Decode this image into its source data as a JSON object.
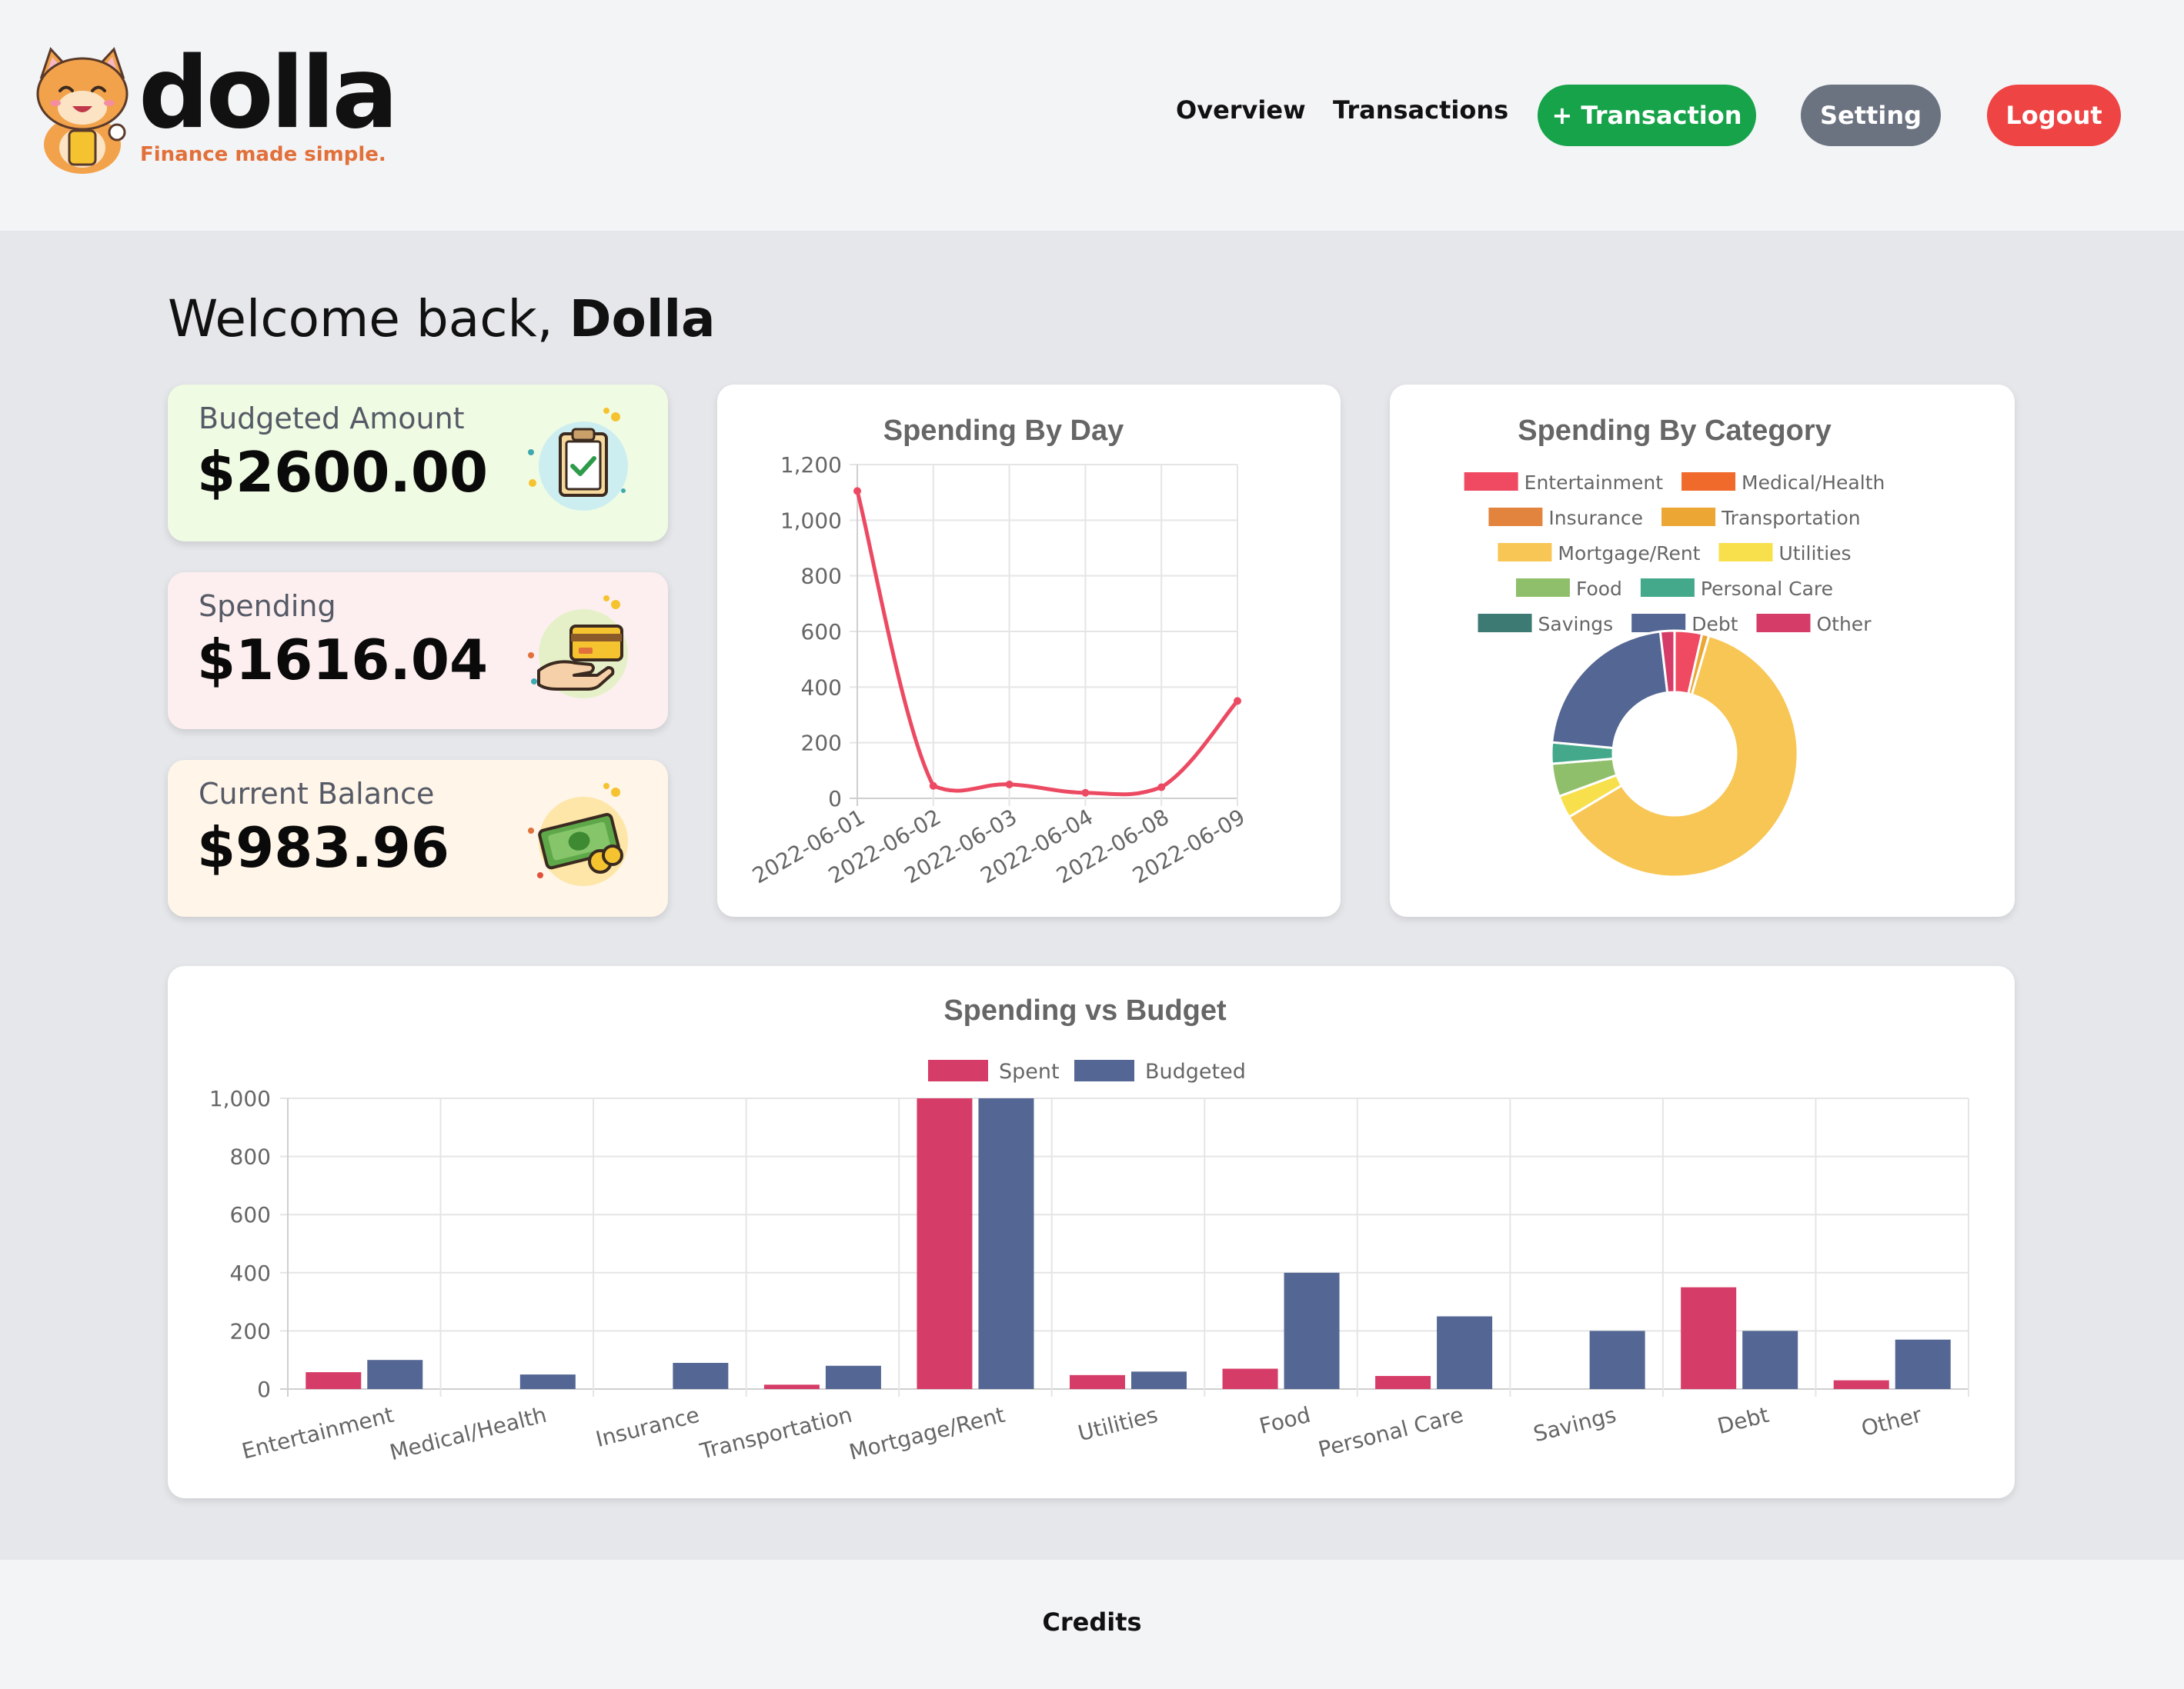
{
  "brand": {
    "name": "dolla",
    "tagline": "Finance made simple."
  },
  "nav": {
    "overview": "Overview",
    "transactions": "Transactions",
    "add_transaction": "+ Transaction",
    "setting": "Setting",
    "logout": "Logout"
  },
  "welcome": {
    "prefix": "Welcome back, ",
    "user": "Dolla"
  },
  "stats": {
    "budgeted": {
      "label": "Budgeted Amount",
      "value": "$2600.00",
      "icon": "clipboard-check-icon"
    },
    "spending": {
      "label": "Spending",
      "value": "$1616.04",
      "icon": "credit-card-hand-icon"
    },
    "balance": {
      "label": "Current Balance",
      "value": "$983.96",
      "icon": "cash-coins-icon"
    }
  },
  "colors": {
    "accent_green": "#16a34a",
    "setting_gray": "#6b7280",
    "logout_red": "#ef4444",
    "line_red": "#ec4a62",
    "spent": "#d63c68",
    "budgeted": "#546693"
  },
  "chart_data": [
    {
      "type": "line",
      "title": "Spending By Day",
      "x": [
        "2022-06-01",
        "2022-06-02",
        "2022-06-03",
        "2022-06-04",
        "2022-06-08",
        "2022-06-09"
      ],
      "values": [
        1105,
        45,
        50,
        20,
        40,
        350
      ],
      "ylim": [
        0,
        1200
      ],
      "yticks": [
        0,
        200,
        400,
        600,
        800,
        1000,
        1200
      ],
      "ytick_labels": [
        "0",
        "200",
        "400",
        "600",
        "800",
        "1,000",
        "1,200"
      ],
      "grid": true,
      "color": "#ec4a62"
    },
    {
      "type": "pie",
      "title": "Spending By Category",
      "donut": true,
      "legend_position": "top",
      "categories": [
        "Entertainment",
        "Medical/Health",
        "Insurance",
        "Transportation",
        "Mortgage/Rent",
        "Utilities",
        "Food",
        "Personal Care",
        "Savings",
        "Debt",
        "Other"
      ],
      "values": [
        58,
        0,
        0,
        15,
        1000,
        48,
        70,
        45,
        0,
        350,
        30
      ],
      "colors": [
        "#ef4a62",
        "#f06a2c",
        "#e3843e",
        "#eba634",
        "#f7c654",
        "#f8e04c",
        "#90bf6c",
        "#43a98a",
        "#3d7a74",
        "#546693",
        "#d63c68"
      ]
    },
    {
      "type": "bar",
      "title": "Spending vs Budget",
      "legend_position": "top",
      "categories": [
        "Entertainment",
        "Medical/Health",
        "Insurance",
        "Transportation",
        "Mortgage/Rent",
        "Utilities",
        "Food",
        "Personal Care",
        "Savings",
        "Debt",
        "Other"
      ],
      "series": [
        {
          "name": "Spent",
          "values": [
            58,
            0,
            0,
            15,
            1000,
            48,
            70,
            45,
            0,
            350,
            30
          ],
          "color": "#d63c68"
        },
        {
          "name": "Budgeted",
          "values": [
            100,
            50,
            90,
            80,
            1000,
            60,
            400,
            250,
            200,
            200,
            170
          ],
          "color": "#546693"
        }
      ],
      "ylim": [
        0,
        1000
      ],
      "yticks": [
        0,
        200,
        400,
        600,
        800,
        1000
      ],
      "ytick_labels": [
        "0",
        "200",
        "400",
        "600",
        "800",
        "1,000"
      ],
      "grid": true
    }
  ],
  "footer": {
    "credits": "Credits"
  }
}
